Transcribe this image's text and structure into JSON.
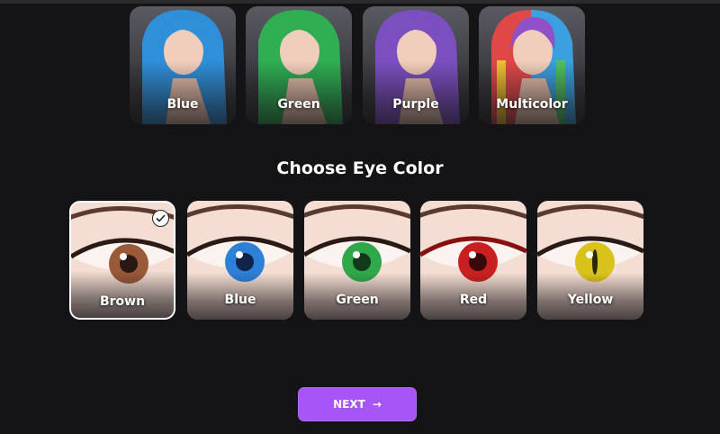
{
  "hair_colors": [
    {
      "label": "Blue",
      "color": "#2f8fd8"
    },
    {
      "label": "Green",
      "color": "#2fae52"
    },
    {
      "label": "Purple",
      "color": "#7b4fc0"
    },
    {
      "label": "Multicolor",
      "color": "#e0a030"
    }
  ],
  "eye_section": {
    "title": "Choose Eye Color",
    "selected": "Brown",
    "options": [
      {
        "label": "Brown",
        "color": "#9a5a3a"
      },
      {
        "label": "Blue",
        "color": "#2e7fd8"
      },
      {
        "label": "Green",
        "color": "#2fa84a"
      },
      {
        "label": "Red",
        "color": "#c82020"
      },
      {
        "label": "Yellow",
        "color": "#d9c21a"
      }
    ]
  },
  "next_button": {
    "label": "NEXT",
    "icon": "arrow-right-icon",
    "color": "#a855f7"
  }
}
